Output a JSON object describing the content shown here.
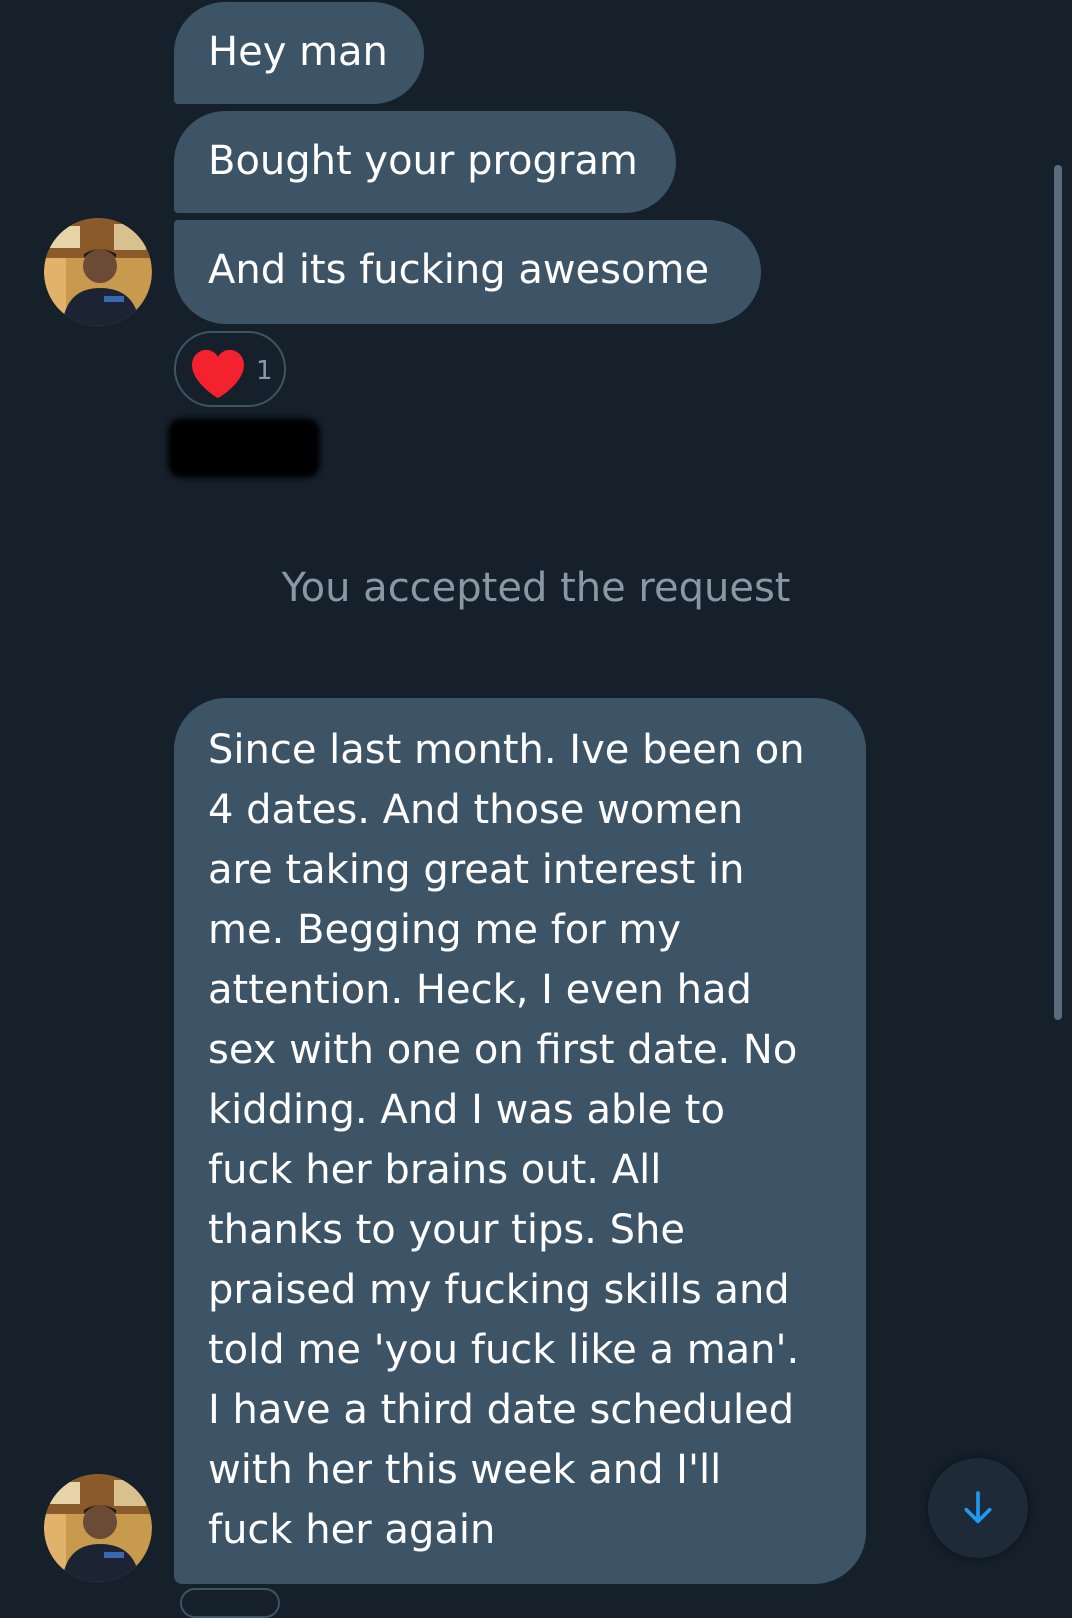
{
  "messages": [
    {
      "text": "Hey man"
    },
    {
      "text": "Bought your program"
    },
    {
      "text": "And its fucking awesome"
    },
    {
      "text": "Since last month. Ive been on\n4 dates. And those women\nare taking great interest in\nme. Begging me for my\nattention. Heck, I even had\nsex with one on first date. No\nkidding. And I was able to\nfuck her brains out. All\nthanks to your tips. She\npraised my fucking skills and\ntold me 'you fuck like a man'.\nI have a third date scheduled\nwith her this week and I'll\nfuck her again"
    }
  ],
  "reaction": {
    "icon": "heart-icon",
    "count": "1",
    "color": "#f4212e"
  },
  "system_message": "You accepted the request",
  "scroll_button": {
    "icon": "arrow-down-icon",
    "color": "#1d9bf0"
  },
  "colors": {
    "background": "#15202b",
    "bubble": "#3d5466",
    "muted_text": "#8899a6"
  }
}
